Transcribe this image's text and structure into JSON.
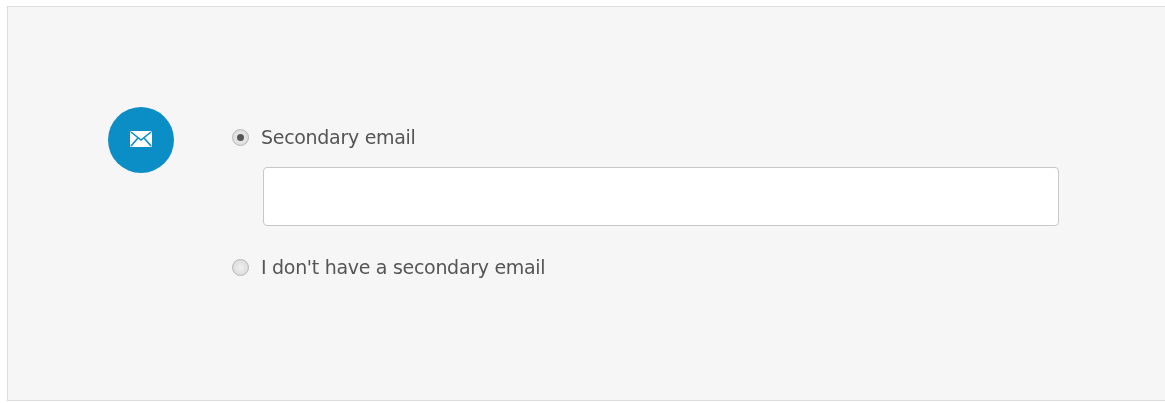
{
  "options": [
    {
      "label": "Secondary email",
      "selected": true,
      "kind": "with_field"
    },
    {
      "label": "I don't have a secondary email",
      "selected": false,
      "kind": "plain"
    }
  ]
}
